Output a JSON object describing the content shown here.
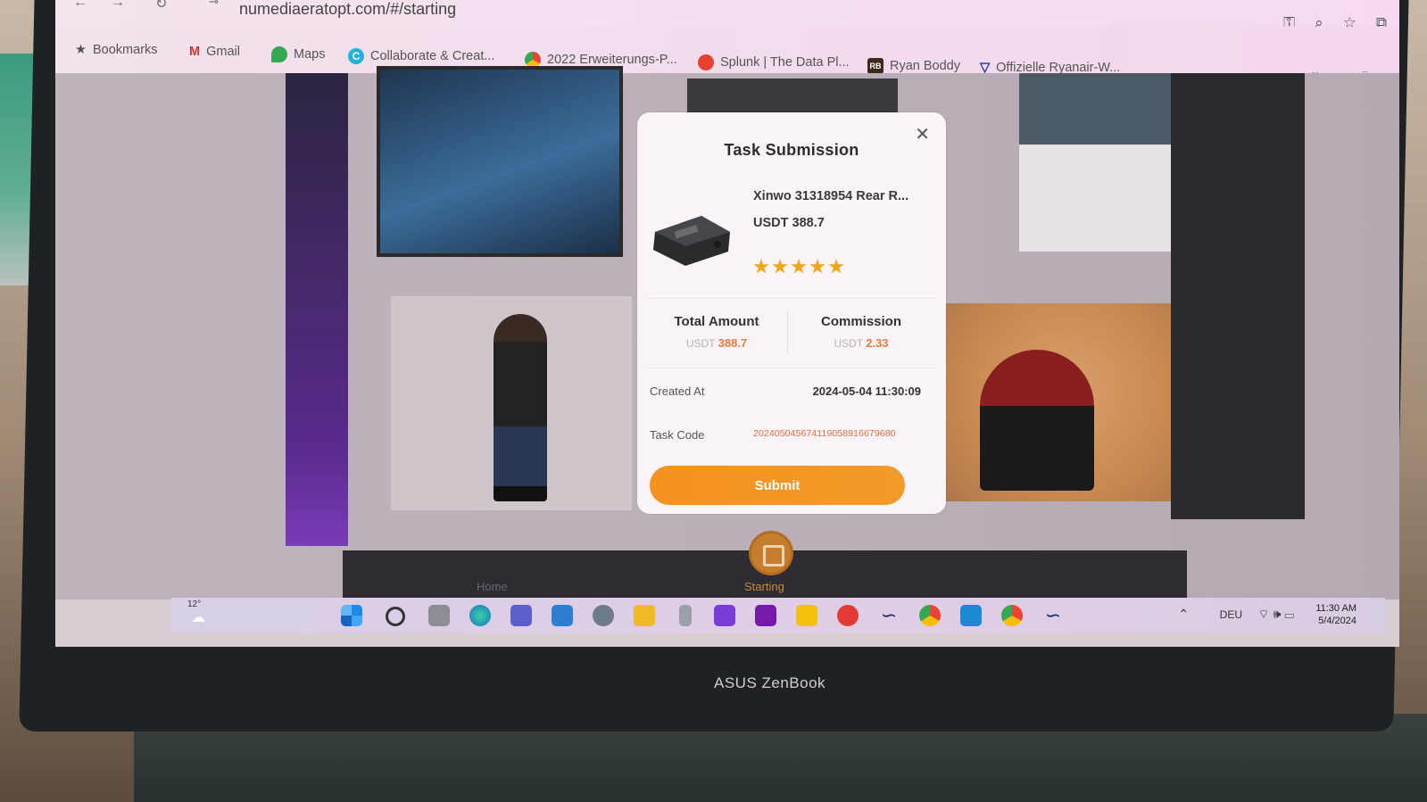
{
  "browser": {
    "url": "numediaeratopt.com/#/starting",
    "bookmarks": [
      {
        "label": "Bookmarks",
        "icon": "star-icon"
      },
      {
        "label": "Gmail",
        "icon": "gmail-icon"
      },
      {
        "label": "Maps",
        "icon": "maps-icon"
      },
      {
        "label": "Collaborate & Creat...",
        "icon": "canva-icon"
      },
      {
        "label": "2022 Erweiterungs-P...",
        "icon": "chrome-icon"
      },
      {
        "label": "Splunk | The Data Pl...",
        "icon": "splunk-icon"
      },
      {
        "label": "Ryan Boddy",
        "icon": "rb-icon",
        "icon_text": "RB"
      },
      {
        "label": "Offizielle Ryanair-W...",
        "icon": "ryanair-icon"
      }
    ],
    "overflow_label": "»"
  },
  "modal": {
    "title": "Task Submission",
    "close_glyph": "✕",
    "product_name": "Xinwo 31318954 Rear R...",
    "product_price": "USDT 388.7",
    "rating": 5,
    "total_amount": {
      "label": "Total Amount",
      "currency": "USDT",
      "value": "388.7"
    },
    "commission": {
      "label": "Commission",
      "currency": "USDT",
      "value": "2.33"
    },
    "created_at_label": "Created At",
    "created_at_value": "2024-05-04 11:30:09",
    "task_code_label": "Task Code",
    "task_code_value": "202405045674119058916679680",
    "submit_label": "Submit"
  },
  "page_nav": {
    "home_label": "Home",
    "starting_label": "Starting"
  },
  "taskbar": {
    "weather": "12°",
    "language": "DEU",
    "time": "11:30 AM",
    "date": "5/4/2024"
  },
  "device": {
    "brand": "ASUS ZenBook"
  },
  "colors": {
    "accent_orange": "#f6921e",
    "value_red": "#ee7a3a",
    "star_yellow": "#f0a51c"
  }
}
